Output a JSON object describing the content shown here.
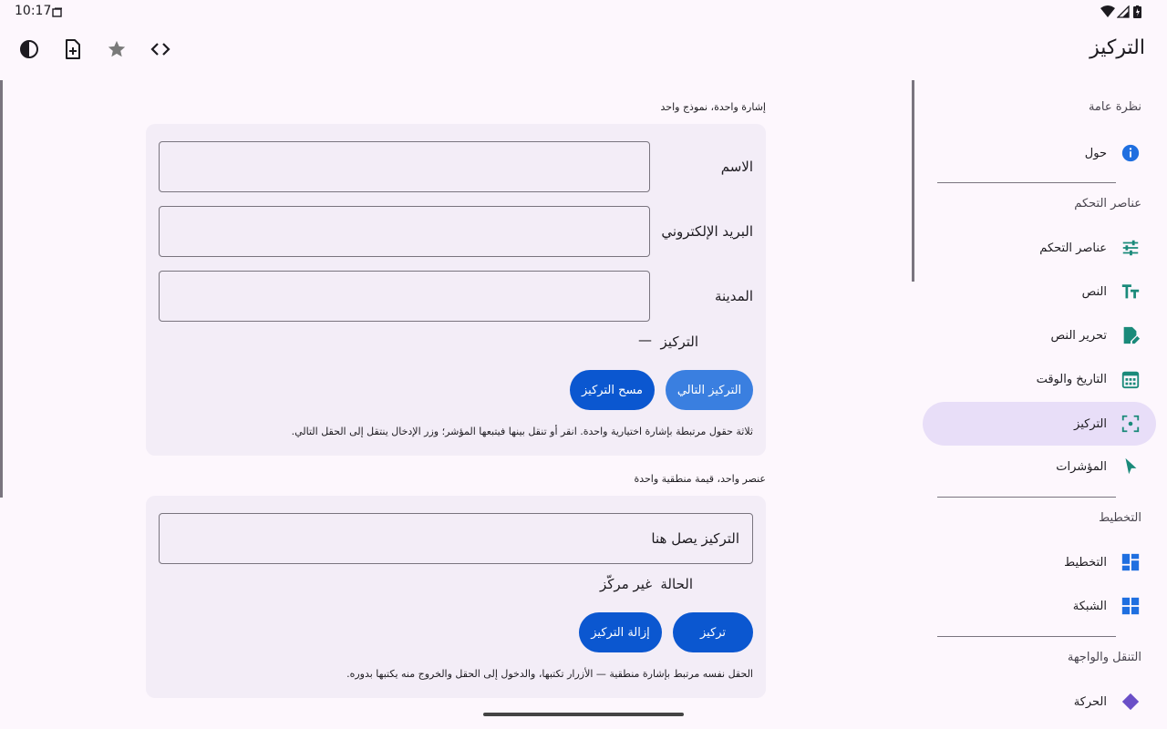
{
  "status": {
    "time": "10:17"
  },
  "app": {
    "title": "التركيز"
  },
  "toolbar": {
    "icons": [
      "contrast-icon",
      "add-document-icon",
      "star-icon",
      "code-icon"
    ]
  },
  "drawer": {
    "sections": {
      "overview": "نظرة عامة",
      "controls": "عناصر التحكم",
      "layout": "التخطيط",
      "navigation": "التنقل والواجهة"
    },
    "items": {
      "about": "حول",
      "controls": "عناصر التحكم",
      "text": "النص",
      "text_edit": "تحرير النص",
      "date_time": "التاريخ والوقت",
      "focus": "التركيز",
      "pointers": "المؤشرات",
      "layout": "التخطيط",
      "grid": "الشبكة",
      "partial": "الحركة"
    },
    "active": "focus",
    "colors": {
      "active_bg": "#e8def8",
      "icon_teal": "#1a8a7a",
      "icon_blue": "#1f6fe0"
    }
  },
  "form1": {
    "caption": "إشارة واحدة، نموذج واحد",
    "fields": {
      "name_label": "الاسم",
      "name_value": "",
      "email_label": "البريد الإلكتروني",
      "email_value": "",
      "city_label": "المدينة",
      "city_value": ""
    },
    "focus_label": "التركيز",
    "focus_value": "—",
    "next_button": "التركيز التالي",
    "clear_button": "مسح التركيز",
    "note": "ثلاثة حقول مرتبطة بإشارة اختيارية واحدة. انقر أو تنقل بينها فيتبعها المؤشر؛ وزر الإدخال ينتقل إلى الحقل التالي."
  },
  "form2": {
    "caption": "عنصر واحد، قيمة منطقية واحدة",
    "field_value": "التركيز يصل هنا",
    "status_label": "الحالة",
    "status_value": "غير مركّز",
    "focus_button": "تركيز",
    "unfocus_button": "إزالة التركيز",
    "note": "الحقل نفسه مرتبط بإشارة منطقية — الأزرار تكتبها، والدخول إلى الحقل والخروج منه يكتبها بدوره."
  },
  "colors": {
    "primary": "#0b57d0",
    "primary_light": "#3a7fe0",
    "card_bg": "#f3edf7",
    "page_bg": "#fdf7fd"
  }
}
